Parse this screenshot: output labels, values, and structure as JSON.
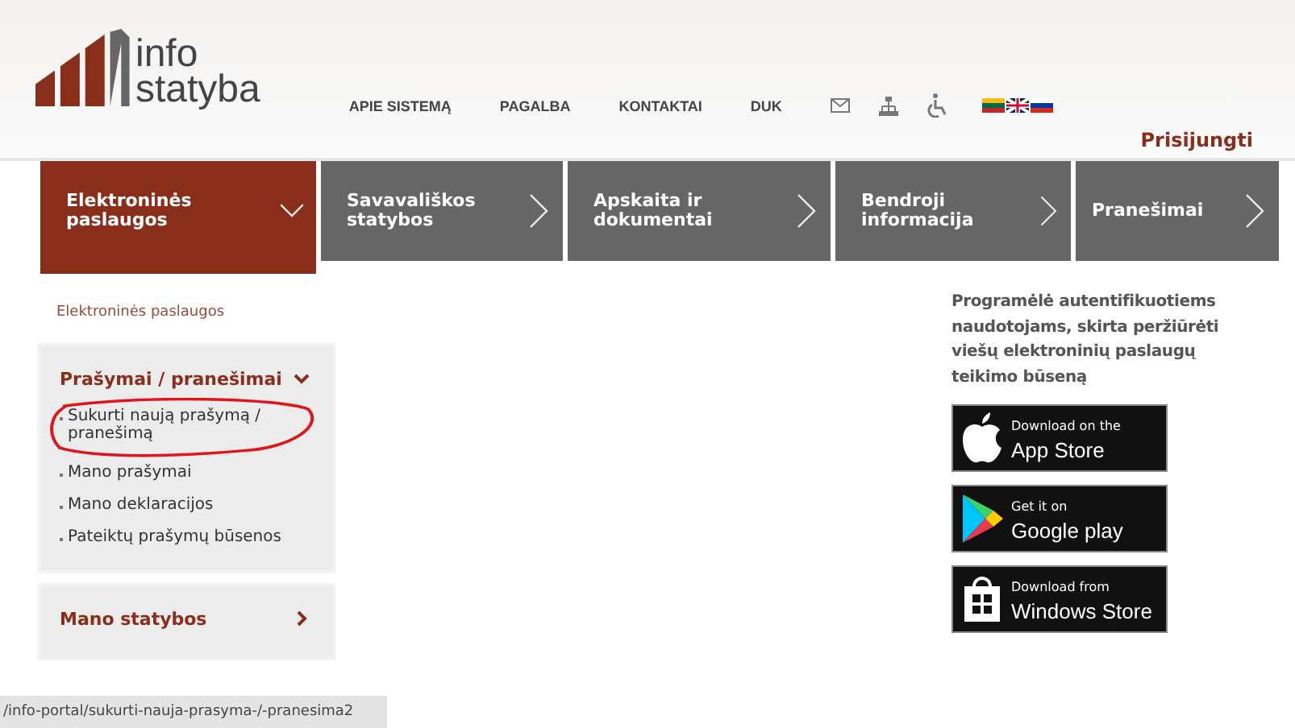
{
  "header": {
    "logo": {
      "line1": "info",
      "line2": "statyba"
    },
    "links": [
      "APIE SISTEMĄ",
      "PAGALBA",
      "KONTAKTAI",
      "DUK"
    ],
    "login": "Prisijungti"
  },
  "nav": {
    "tabs": [
      {
        "label": "Elektroninės paslaugos",
        "selected": true
      },
      {
        "label": "Savavališkos statybos",
        "selected": false
      },
      {
        "label": "Apskaita ir dokumentai",
        "selected": false
      },
      {
        "label": "Bendroji informacija",
        "selected": false
      },
      {
        "label": "Pranešimai",
        "selected": false
      }
    ]
  },
  "breadcrumb": "Elektroninės paslaugos",
  "sidebar": {
    "panels": [
      {
        "title": "Prašymai / pranešimai",
        "expanded": true,
        "items": [
          "Sukurti naują prašymą / pranešimą",
          "Mano prašymai",
          "Mano deklaracijos",
          "Pateiktų prašymų būsenos"
        ]
      },
      {
        "title": "Mano statybos",
        "expanded": false
      }
    ]
  },
  "app_promo": {
    "text": "Programėlė autentifikuotiems naudotojams, skirta peržiūrėti viešų elektroninių paslaugų teikimo būseną",
    "badges": [
      {
        "kind": "apple",
        "small": "Download on the",
        "big": "App Store"
      },
      {
        "kind": "google",
        "small": "Get it on",
        "big": "Google play"
      },
      {
        "kind": "windows",
        "small": "Download from",
        "big": "Windows Store"
      }
    ]
  },
  "status_bar": "/info-portal/sukurti-nauja-prasyma-/-pranesima2"
}
